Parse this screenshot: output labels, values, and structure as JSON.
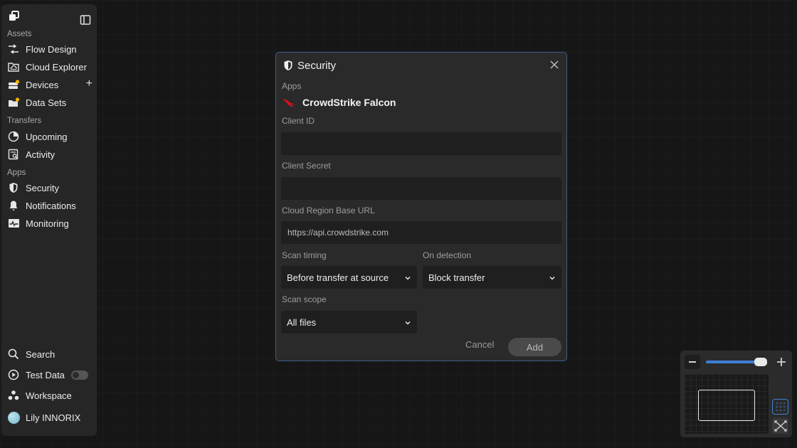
{
  "sidebar": {
    "sections": [
      {
        "label": "Assets"
      },
      {
        "label": "Transfers"
      },
      {
        "label": "Apps"
      }
    ],
    "items": [
      {
        "label": "Flow Design",
        "icon": "flow-icon"
      },
      {
        "label": "Cloud Explorer",
        "icon": "cloud-folder-icon"
      },
      {
        "label": "Devices",
        "icon": "devices-icon"
      },
      {
        "label": "Data Sets",
        "icon": "data-sets-icon"
      },
      {
        "label": "Upcoming",
        "icon": "pie-clock-icon"
      },
      {
        "label": "Activity",
        "icon": "activity-icon"
      },
      {
        "label": "Security",
        "icon": "shield-icon"
      },
      {
        "label": "Notifications",
        "icon": "bell-icon"
      },
      {
        "label": "Monitoring",
        "icon": "monitor-icon"
      }
    ],
    "bottom": {
      "search": "Search",
      "test_data": "Test Data",
      "test_data_enabled": false,
      "workspace": "Workspace",
      "user": "Lily INNORIX"
    },
    "badge_color": "#f5b400"
  },
  "modal": {
    "title": "Security",
    "apps_label": "Apps",
    "app_name": "CrowdStrike Falcon",
    "client_id_label": "Client ID",
    "client_id_value": "",
    "client_secret_label": "Client Secret",
    "client_secret_value": "",
    "region_label": "Cloud Region Base URL",
    "region_placeholder": "https://api.crowdstrike.com",
    "scan_timing_label": "Scan timing",
    "scan_timing_value": "Before transfer at source",
    "on_detection_label": "On detection",
    "on_detection_value": "Block transfer",
    "scan_scope_label": "Scan scope",
    "scan_scope_value": "All files",
    "cancel_label": "Cancel",
    "add_label": "Add",
    "accent_color": "#3b5e8a",
    "brand_color": "#e0101e"
  },
  "zoom": {
    "level": 0.85,
    "accent_color": "#3f7fd6"
  }
}
